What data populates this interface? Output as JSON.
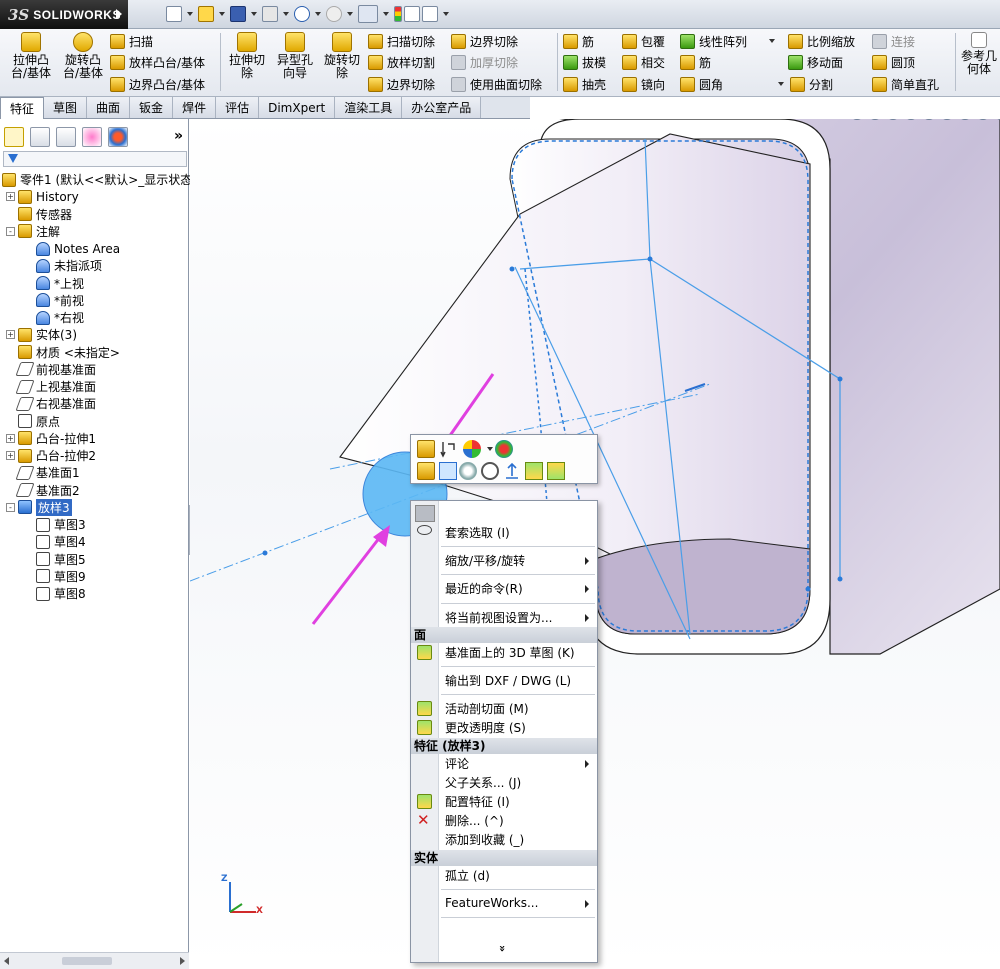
{
  "app": {
    "logo_ds": "3S",
    "logo_brand": "SOLIDWORKS"
  },
  "command_manager": {
    "big": [
      {
        "id": "extrude-boss",
        "label": "拉伸凸\n台/基体"
      },
      {
        "id": "revolve-boss",
        "label": "旋转凸\n台/基体"
      },
      {
        "id": "extruded-cut",
        "label": "拉伸切\n除"
      },
      {
        "id": "hole-wizard",
        "label": "异型孔\n向导"
      },
      {
        "id": "revolved-cut",
        "label": "旋转切\n除"
      },
      {
        "id": "reference-geometry",
        "label": "参考几\n何体"
      }
    ],
    "small": [
      {
        "id": "sweep",
        "label": "扫描",
        "state": "enabled"
      },
      {
        "id": "loft",
        "label": "放样凸台/基体",
        "state": "enabled"
      },
      {
        "id": "boundary-boss",
        "label": "边界凸台/基体",
        "state": "enabled"
      },
      {
        "id": "swept-cut",
        "label": "扫描切除",
        "state": "enabled"
      },
      {
        "id": "lofted-cut",
        "label": "放样切割",
        "state": "enabled"
      },
      {
        "id": "boundary-cut-2",
        "label": "边界切除",
        "state": "enabled"
      },
      {
        "id": "boundary-cut",
        "label": "边界切除",
        "state": "enabled"
      },
      {
        "id": "thicken-cut",
        "label": "加厚切除",
        "state": "disabled"
      },
      {
        "id": "surface-cut",
        "label": "使用曲面切除",
        "state": "enabled"
      },
      {
        "id": "rib",
        "label": "筋",
        "state": "enabled"
      },
      {
        "id": "draft",
        "label": "拔模",
        "state": "enabled"
      },
      {
        "id": "shell",
        "label": "抽壳",
        "state": "enabled"
      },
      {
        "id": "wrap",
        "label": "包覆",
        "state": "enabled"
      },
      {
        "id": "intersect",
        "label": "相交",
        "state": "enabled"
      },
      {
        "id": "mirror",
        "label": "镜向",
        "state": "enabled"
      },
      {
        "id": "linear-pattern",
        "label": "线性阵列",
        "state": "enabled"
      },
      {
        "id": "rib-2",
        "label": "筋",
        "state": "enabled"
      },
      {
        "id": "fillet",
        "label": "圆角",
        "state": "enabled"
      },
      {
        "id": "scale",
        "label": "比例缩放",
        "state": "enabled"
      },
      {
        "id": "move-face",
        "label": "移动面",
        "state": "enabled"
      },
      {
        "id": "split",
        "label": "分割",
        "state": "enabled"
      },
      {
        "id": "connect",
        "label": "连接",
        "state": "disabled"
      },
      {
        "id": "dome",
        "label": "圆顶",
        "state": "enabled"
      },
      {
        "id": "simple-hole",
        "label": "简单直孔",
        "state": "enabled"
      }
    ]
  },
  "tabs": [
    "特征",
    "草图",
    "曲面",
    "钣金",
    "焊件",
    "评估",
    "DimXpert",
    "渲染工具",
    "办公室产品"
  ],
  "tree": [
    {
      "label": "零件1 (默认<<默认>_显示状态",
      "level": 0,
      "icon": "part",
      "expand": ""
    },
    {
      "label": "History",
      "level": 1,
      "icon": "history",
      "expand": "+"
    },
    {
      "label": "传感器",
      "level": 1,
      "icon": "sensor",
      "expand": ""
    },
    {
      "label": "注解",
      "level": 1,
      "icon": "annotation",
      "expand": "-"
    },
    {
      "label": "Notes Area",
      "level": 2,
      "icon": "note",
      "expand": ""
    },
    {
      "label": "未指派项",
      "level": 2,
      "icon": "note",
      "expand": ""
    },
    {
      "label": "*上视",
      "level": 2,
      "icon": "note",
      "expand": ""
    },
    {
      "label": "*前视",
      "level": 2,
      "icon": "note",
      "expand": ""
    },
    {
      "label": "*右视",
      "level": 2,
      "icon": "note",
      "expand": ""
    },
    {
      "label": "实体(3)",
      "level": 1,
      "icon": "solid",
      "expand": "+"
    },
    {
      "label": "材质 <未指定>",
      "level": 1,
      "icon": "material",
      "expand": ""
    },
    {
      "label": "前视基准面",
      "level": 1,
      "icon": "plane",
      "expand": ""
    },
    {
      "label": "上视基准面",
      "level": 1,
      "icon": "plane",
      "expand": ""
    },
    {
      "label": "右视基准面",
      "level": 1,
      "icon": "plane",
      "expand": ""
    },
    {
      "label": "原点",
      "level": 1,
      "icon": "origin",
      "expand": ""
    },
    {
      "label": "凸台-拉伸1",
      "level": 1,
      "icon": "extrude",
      "expand": "+"
    },
    {
      "label": "凸台-拉伸2",
      "level": 1,
      "icon": "extrude",
      "expand": "+"
    },
    {
      "label": "基准面1",
      "level": 1,
      "icon": "plane",
      "expand": ""
    },
    {
      "label": "基准面2",
      "level": 1,
      "icon": "plane",
      "expand": ""
    },
    {
      "label": "放样3",
      "level": 1,
      "icon": "loft",
      "expand": "-",
      "selected": true
    },
    {
      "label": "草图3",
      "level": 2,
      "icon": "sketch",
      "expand": ""
    },
    {
      "label": "草图4",
      "level": 2,
      "icon": "sketch",
      "expand": ""
    },
    {
      "label": "草图5",
      "level": 2,
      "icon": "sketch",
      "expand": ""
    },
    {
      "label": "草图9",
      "level": 2,
      "icon": "sketch",
      "expand": ""
    },
    {
      "label": "草图8",
      "level": 2,
      "icon": "sketch",
      "expand": ""
    }
  ],
  "triad": {
    "z": "Z",
    "x": "X"
  },
  "context_menu": {
    "items": [
      {
        "type": "blank"
      },
      {
        "type": "item",
        "label": "套索选取 (I)",
        "submenu": false,
        "icon": "lasso-icon"
      },
      {
        "type": "sep"
      },
      {
        "type": "item",
        "label": "缩放/平移/旋转",
        "submenu": true
      },
      {
        "type": "sep"
      },
      {
        "type": "item",
        "label": "最近的命令(R)",
        "submenu": true
      },
      {
        "type": "sep"
      },
      {
        "type": "item",
        "label": "将当前视图设置为...",
        "submenu": true
      },
      {
        "type": "header",
        "label": "面"
      },
      {
        "type": "item",
        "label": "基准面上的 3D 草图 (K)",
        "submenu": false,
        "icon": "3d-sketch-icon"
      },
      {
        "type": "sep"
      },
      {
        "type": "item",
        "label": "输出到 DXF / DWG (L)",
        "submenu": false
      },
      {
        "type": "sep"
      },
      {
        "type": "item",
        "label": "活动剖切面 (M)",
        "submenu": false,
        "icon": "section-icon"
      },
      {
        "type": "item",
        "label": "更改透明度 (S)",
        "submenu": false,
        "icon": "transparency-icon"
      },
      {
        "type": "header",
        "label": "特征 (放样3)"
      },
      {
        "type": "item",
        "label": "评论",
        "submenu": true
      },
      {
        "type": "item",
        "label": "父子关系... (J)",
        "submenu": false
      },
      {
        "type": "item",
        "label": "配置特征 (I)",
        "submenu": false,
        "icon": "config-icon"
      },
      {
        "type": "item",
        "label": "删除... (^)",
        "submenu": false,
        "icon": "delete-icon"
      },
      {
        "type": "item",
        "label": "添加到收藏 (_)",
        "submenu": false
      },
      {
        "type": "header",
        "label": "实体"
      },
      {
        "type": "item",
        "label": "孤立 (d)",
        "submenu": false
      },
      {
        "type": "sep"
      },
      {
        "type": "item",
        "label": "FeatureWorks...",
        "submenu": true
      },
      {
        "type": "sep"
      }
    ],
    "more_glyph": "»"
  },
  "colors": {
    "accent": "#316ac5",
    "sketch_line": "#4a9ee8",
    "annotation_arrow": "#e040e0",
    "face_highlight": "#5bb8f5"
  }
}
